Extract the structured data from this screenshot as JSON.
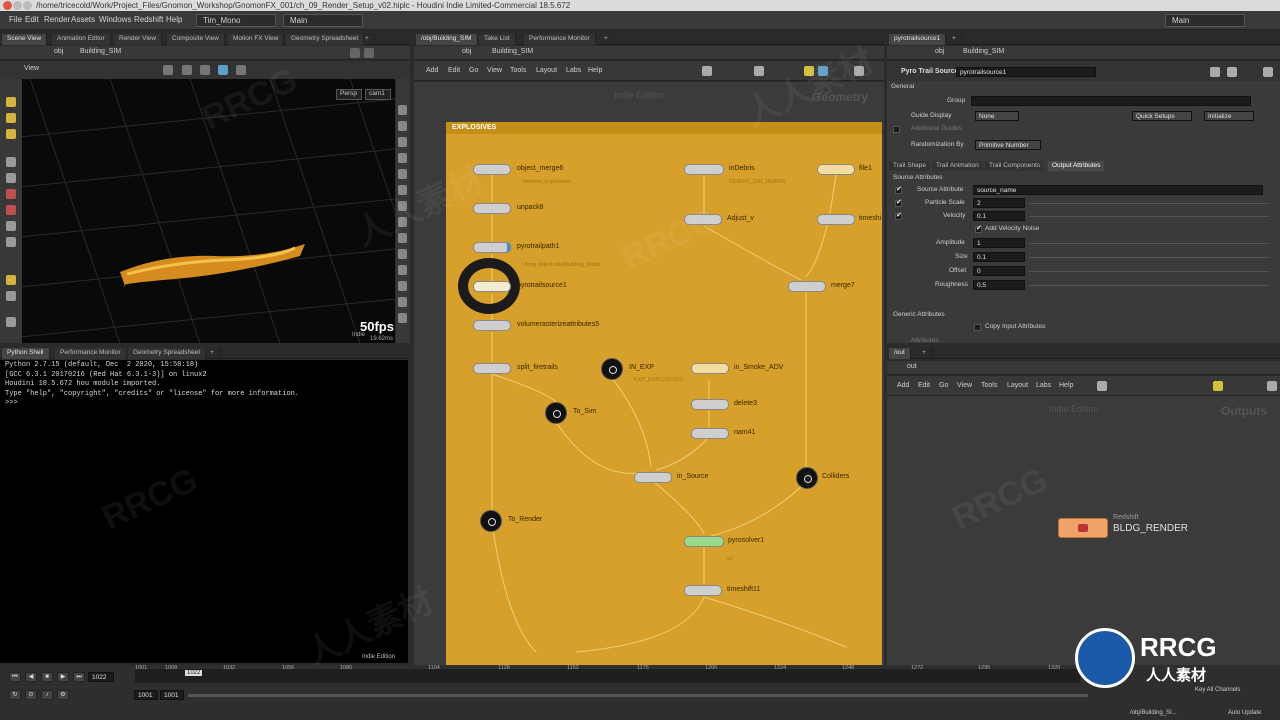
{
  "titlebar": {
    "text": "/home/tricecold/Work/Project_Files/Gnomon_Workshop/GnomonFX_001/ch_09_Render_Setup_v02.hiplc - Houdini Indie Limited-Commercial 18.5.672"
  },
  "menu": {
    "items": [
      "File",
      "Edit",
      "Render",
      "Assets",
      "Windows",
      "Redshift",
      "Help"
    ],
    "desktop": "Tim_Mono",
    "shelf": "Main",
    "right_shelf": "Main"
  },
  "left_top": {
    "tabs": [
      "Scene View",
      "Animation Editor",
      "Render View",
      "Composite View",
      "Motion FX View",
      "Geometry Spreadsheet"
    ],
    "path": "obj",
    "path2": "Building_SIM",
    "view_label": "View",
    "persp": "Persp",
    "cam": "cam1",
    "fps": "50fps",
    "ms": "19.62ms",
    "indie": "Indie"
  },
  "left_bottom": {
    "tabs": [
      "Python Shell",
      "Performance Monitor",
      "Geometry Spreadsheet"
    ],
    "lines": [
      "Python 2.7.15 (default, Dec  2 2020, 15:50:18)",
      "[GCC 6.3.1 20170216 (Red Hat 6.3.1-3)] on linux2",
      "Houdini 18.5.672 hou module imported.",
      "Type \"help\", \"copyright\", \"credits\" or \"license\" for more information.",
      ">>> "
    ],
    "edition": "Indie Edition"
  },
  "network": {
    "tabs": [
      "/obj/Building_SIM",
      "Take List",
      "Performance Monitor"
    ],
    "path": "obj",
    "path2": "Building_SIM",
    "menu": [
      "Add",
      "Edit",
      "Go",
      "View",
      "Tools",
      "Layout",
      "Labs",
      "Help"
    ],
    "edition": "Indie Edition",
    "context": "Geometry",
    "box_title": "EXPLOSIVES",
    "nodes": [
      {
        "name": "object_merge6",
        "sub": "Window_Explosives"
      },
      {
        "name": "unpack8",
        "sub": ""
      },
      {
        "name": "pyrotrailpath1",
        "sub": ""
      },
      {
        "name": "pyrotrailsource1",
        "sub": "Using object:/obj/Building_Mode"
      },
      {
        "name": "volumerasterizeattributes5",
        "sub": ""
      },
      {
        "name": "split_firetrails",
        "sub": ""
      },
      {
        "name": "IN_EXP",
        "sub": "EXP_EXPLOSIVES"
      },
      {
        "name": "To_Sim",
        "sub": ""
      },
      {
        "name": "To_Render",
        "sub": ""
      },
      {
        "name": "inDebris",
        "sub": "DEBRIS_SIM_DEBRIS"
      },
      {
        "name": "Adjust_v",
        "sub": ""
      },
      {
        "name": "file1",
        "sub": ""
      },
      {
        "name": "timeshi",
        "sub": ""
      },
      {
        "name": "merge7",
        "sub": ""
      },
      {
        "name": "in_Smoke_ADV",
        "sub": ""
      },
      {
        "name": "delete3",
        "sub": ""
      },
      {
        "name": "nam41",
        "sub": ""
      },
      {
        "name": "in_Source",
        "sub": ""
      },
      {
        "name": "Colliders",
        "sub": ""
      },
      {
        "name": "pyrosolver1",
        "sub": "x2"
      },
      {
        "name": "timeshift11",
        "sub": ""
      }
    ]
  },
  "params": {
    "tabs": [
      "pyrotrailsource1"
    ],
    "path": "obj",
    "path2": "Building_SIM",
    "node_type": "Pyro Trail Source",
    "node_name": "pyrotrailsource1",
    "section": "General",
    "group_label": "Group",
    "group_value": "",
    "guide_label": "Guide Display",
    "guide_value": "None",
    "quick_setup": "Quick Setups",
    "initialize": "Initialize",
    "additional_guides": "Additional Guides",
    "random_label": "Randomization By",
    "random_value": "Primitive Number",
    "subtabs": [
      "Trail Shape",
      "Trail Animation",
      "Trail Components",
      "Output Attributes"
    ],
    "source_attrs": "Source Attributes",
    "src_attr_label": "Source Attribute",
    "src_attr_value": "source_name",
    "pscale_label": "Particle Scale",
    "pscale_value": "2",
    "vel_label": "Velocity",
    "vel_value": "0.1",
    "addnoise_label": "Add Velocity Noise",
    "amp_label": "Amplitude",
    "amp_value": "1",
    "size_label": "Size",
    "size_value": "0.1",
    "offset_label": "Offset",
    "offset_value": "0",
    "rough_label": "Roughness",
    "rough_value": "0.5",
    "generic": "Generic Attributes",
    "copy_input": "Copy Input Attributes",
    "attributes": "Attributes"
  },
  "out": {
    "tabs": [
      "/out"
    ],
    "path": "out",
    "menu": [
      "Add",
      "Edit",
      "Go",
      "View",
      "Tools",
      "Layout",
      "Labs",
      "Help"
    ],
    "edition": "Indie Edition",
    "context": "Outputs",
    "node_type": "Redshift",
    "node_name": "BLDG_RENDER"
  },
  "timeline": {
    "frame": "1022",
    "marker": "1022",
    "start": "1001",
    "start2": "1001",
    "ticks": [
      "1001",
      "1008",
      "1032",
      "1056",
      "1080",
      "1104",
      "1128",
      "1152",
      "1176",
      "1200",
      "1224",
      "1248",
      "1272",
      "1295",
      "1320"
    ],
    "key_all": "Key All Channels",
    "obj_path": "/obj/Building_SI...",
    "auto_update": "Auto Update"
  },
  "watermarks": [
    "RRCG",
    "人人素材"
  ],
  "brand": {
    "logo": "RRCG",
    "cn": "人人素材"
  }
}
